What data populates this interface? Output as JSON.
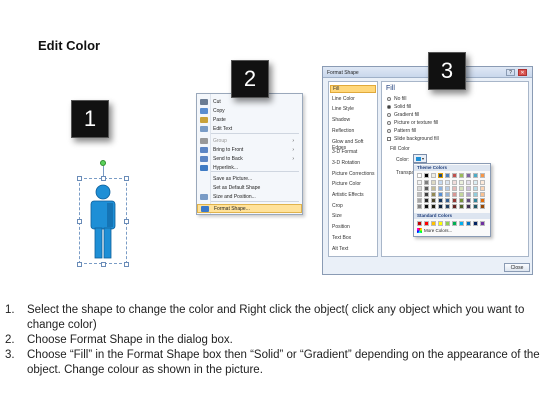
{
  "title": "Edit Color",
  "steps": [
    "1",
    "2",
    "3"
  ],
  "context_menu": {
    "items": [
      {
        "label": "Cut",
        "icon": "scissors-icon"
      },
      {
        "label": "Copy",
        "icon": "copy-icon"
      },
      {
        "label": "Paste",
        "icon": "paste-icon"
      },
      {
        "label": "Edit Text",
        "icon": "edit-text-icon"
      },
      {
        "label": "Group",
        "icon": "group-icon",
        "disabled": true,
        "submenu": true
      },
      {
        "label": "Bring to Front",
        "icon": "bring-to-front-icon",
        "submenu": true
      },
      {
        "label": "Send to Back",
        "icon": "send-to-back-icon",
        "submenu": true
      },
      {
        "label": "Hyperlink...",
        "icon": "hyperlink-icon"
      },
      {
        "label": "Save as Picture...",
        "icon": ""
      },
      {
        "label": "Set as Default Shape",
        "icon": ""
      },
      {
        "label": "Size and Position...",
        "icon": "size-position-icon"
      },
      {
        "label": "Format Shape...",
        "icon": "format-shape-icon",
        "highlighted": true
      }
    ],
    "arrow": "›"
  },
  "dialog": {
    "title": "Format Shape",
    "help": "?",
    "close_x": "✕",
    "nav": [
      "Fill",
      "Line Color",
      "Line Style",
      "Shadow",
      "Reflection",
      "Glow and Soft Edges",
      "3-D Format",
      "3-D Rotation",
      "Picture Corrections",
      "Picture Color",
      "Artistic Effects",
      "Crop",
      "Size",
      "Position",
      "Text Box",
      "Alt Text"
    ],
    "pane_title": "Fill",
    "options": [
      {
        "label": "No fill",
        "type": "radio",
        "on": false
      },
      {
        "label": "Solid fill",
        "type": "radio",
        "on": true
      },
      {
        "label": "Gradient fill",
        "type": "radio",
        "on": false
      },
      {
        "label": "Picture or texture fill",
        "type": "radio",
        "on": false
      },
      {
        "label": "Pattern fill",
        "type": "radio",
        "on": false
      },
      {
        "label": "Slide background fill",
        "type": "checkbox",
        "on": false
      }
    ],
    "fill_color_label": "Fill Color",
    "color_label": "Color:",
    "transparency_label": "Transpa",
    "close_label": "Close"
  },
  "color_popup": {
    "theme_header": "Theme Colors",
    "standard_header": "Standard Colors",
    "more_colors": "More Colors...",
    "theme_top": [
      "#ffffff",
      "#000000",
      "#eeece1",
      "#1f497d",
      "#4f81bd",
      "#c0504d",
      "#9bbb59",
      "#8064a2",
      "#4bacc6",
      "#f79646"
    ],
    "theme_shades": [
      [
        "#f2f2f2",
        "#7f7f7f",
        "#ddd9c3",
        "#c6d9f0",
        "#dbe5f1",
        "#f2dcdb",
        "#ebf1dd",
        "#e5e0ec",
        "#dbeef3",
        "#fdeada"
      ],
      [
        "#d8d8d8",
        "#595959",
        "#c4bd97",
        "#8db3e2",
        "#b8cce4",
        "#e5b9b7",
        "#d7e3bc",
        "#ccc1d9",
        "#b7dde8",
        "#fbd5b5"
      ],
      [
        "#bfbfbf",
        "#3f3f3f",
        "#938953",
        "#548dd4",
        "#95b3d7",
        "#d99694",
        "#c3d69b",
        "#b2a2c7",
        "#92cddc",
        "#fac08f"
      ],
      [
        "#a5a5a5",
        "#262626",
        "#494429",
        "#17365d",
        "#366092",
        "#953734",
        "#76923c",
        "#5f497a",
        "#31859b",
        "#e36c09"
      ],
      [
        "#7f7f7f",
        "#0c0c0c",
        "#1d1b10",
        "#0f243e",
        "#244061",
        "#632423",
        "#4f6128",
        "#3f3151",
        "#205867",
        "#974806"
      ]
    ],
    "standard": [
      "#c00000",
      "#ff0000",
      "#ffc000",
      "#ffff00",
      "#92d050",
      "#00b050",
      "#00b0f0",
      "#0070c0",
      "#002060",
      "#7030a0"
    ]
  },
  "shape": {
    "fill": "#1e8fd6",
    "dark": "#0e5f9a",
    "icon": "person-icon"
  },
  "instructions": [
    {
      "n": "1.",
      "text": "Select the shape to change the color and Right click the object( click any object which you want to change color)"
    },
    {
      "n": "2.",
      "text": "Choose Format Shape in the dialog box."
    },
    {
      "n": "3.",
      "text": "Choose “Fill” in the Format Shape box then “Solid” or “Gradient” depending on the appearance of the object. Change colour as shown in the picture."
    }
  ]
}
